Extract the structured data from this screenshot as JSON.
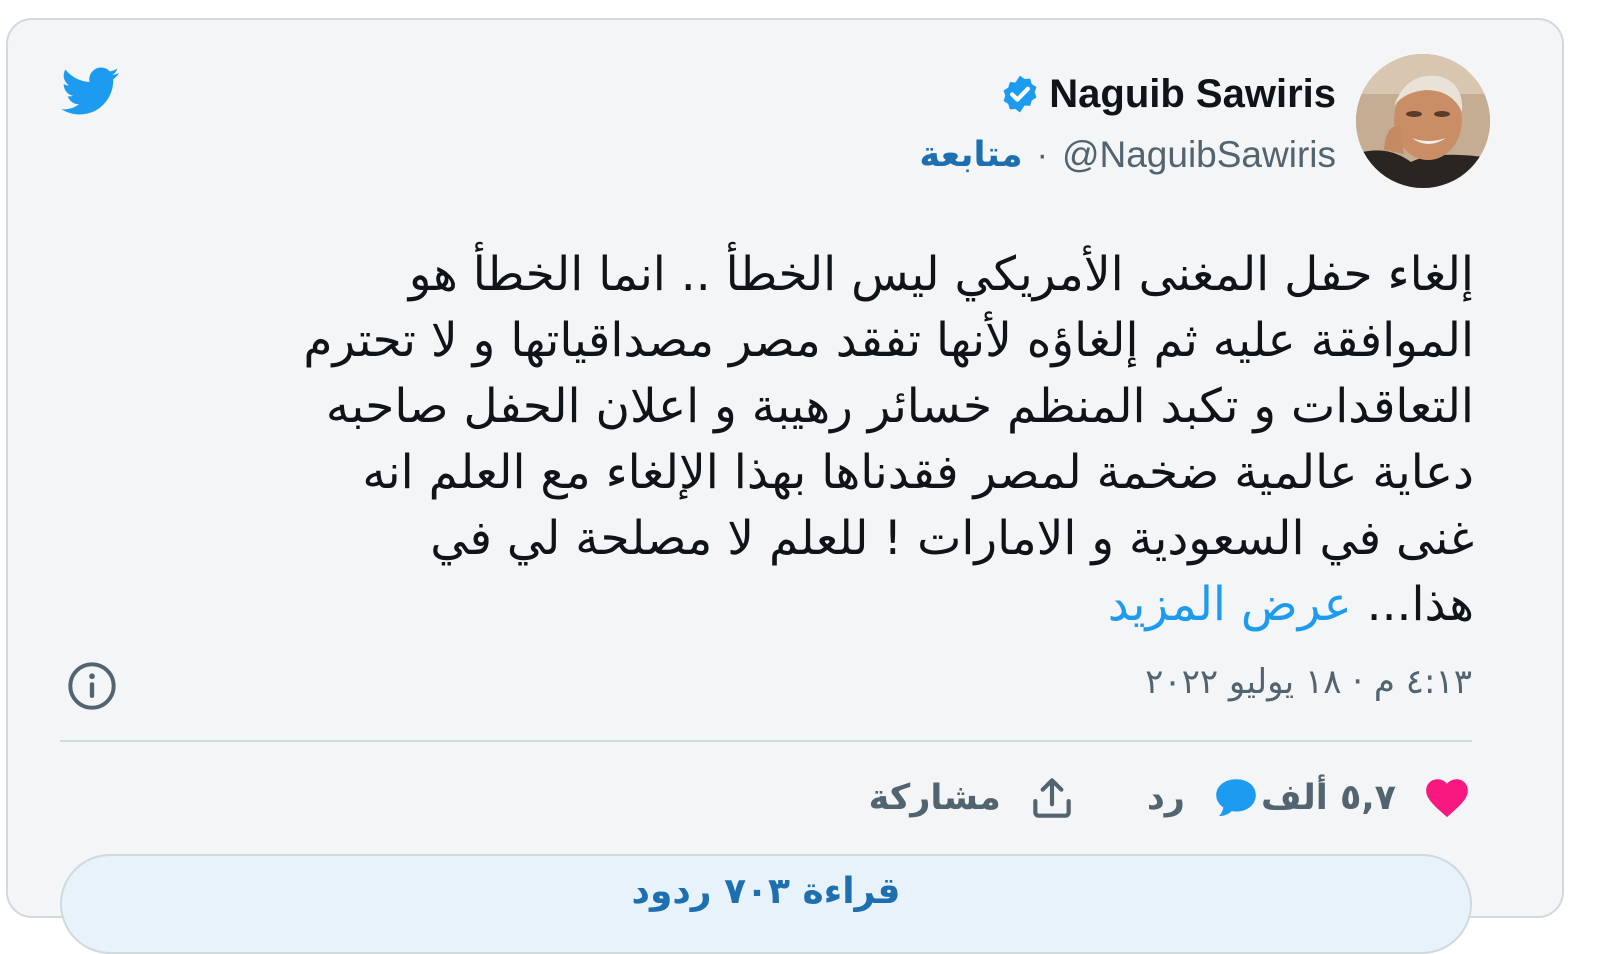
{
  "colors": {
    "card_bg": "#f3f5f6",
    "border": "#cfd9de",
    "text_primary": "#0f1419",
    "text_secondary": "#536471",
    "link": "#1d9bf0",
    "follow": "#1d6fb0",
    "verified": "#1d9bf0",
    "like": "#f91880",
    "twitter_brand": "#1d9bf0"
  },
  "icons": {
    "logo": "twitter-bird-icon",
    "verified": "verified-badge-icon",
    "info": "info-icon",
    "like": "heart-icon",
    "reply": "speech-bubble-icon",
    "share": "share-upload-icon"
  },
  "author": {
    "display_name": "Naguib Sawiris",
    "handle": "@NaguibSawiris",
    "separator": "·",
    "follow_label": "متابعة"
  },
  "tweet": {
    "lines": [
      "إلغاء حفل المغنى الأمريكي ليس الخطأ .. انما الخطأ هو",
      "الموافقة عليه ثم إلغاؤه لأنها تفقد مصر مصداقياتها و لا تحترم",
      "التعاقدات و تكبد المنظم خسائر رهيبة و اعلان الحفل صاحبه",
      "دعاية عالمية ضخمة لمصر فقدناها بهذا الإلغاء مع العلم انه",
      "غنى في السعودية و الامارات ! للعلم لا مصلحة لي في"
    ],
    "last_line": "هذا...",
    "show_more": "عرض المزيد",
    "timestamp": "٤:١٣ م · ١٨ يوليو ٢٠٢٢"
  },
  "actions": {
    "likes_count": "٥,٧ ألف",
    "reply_label": "رد",
    "share_label": "مشاركة"
  },
  "read_replies_label": "قراءة ٧٠٣ ردود"
}
